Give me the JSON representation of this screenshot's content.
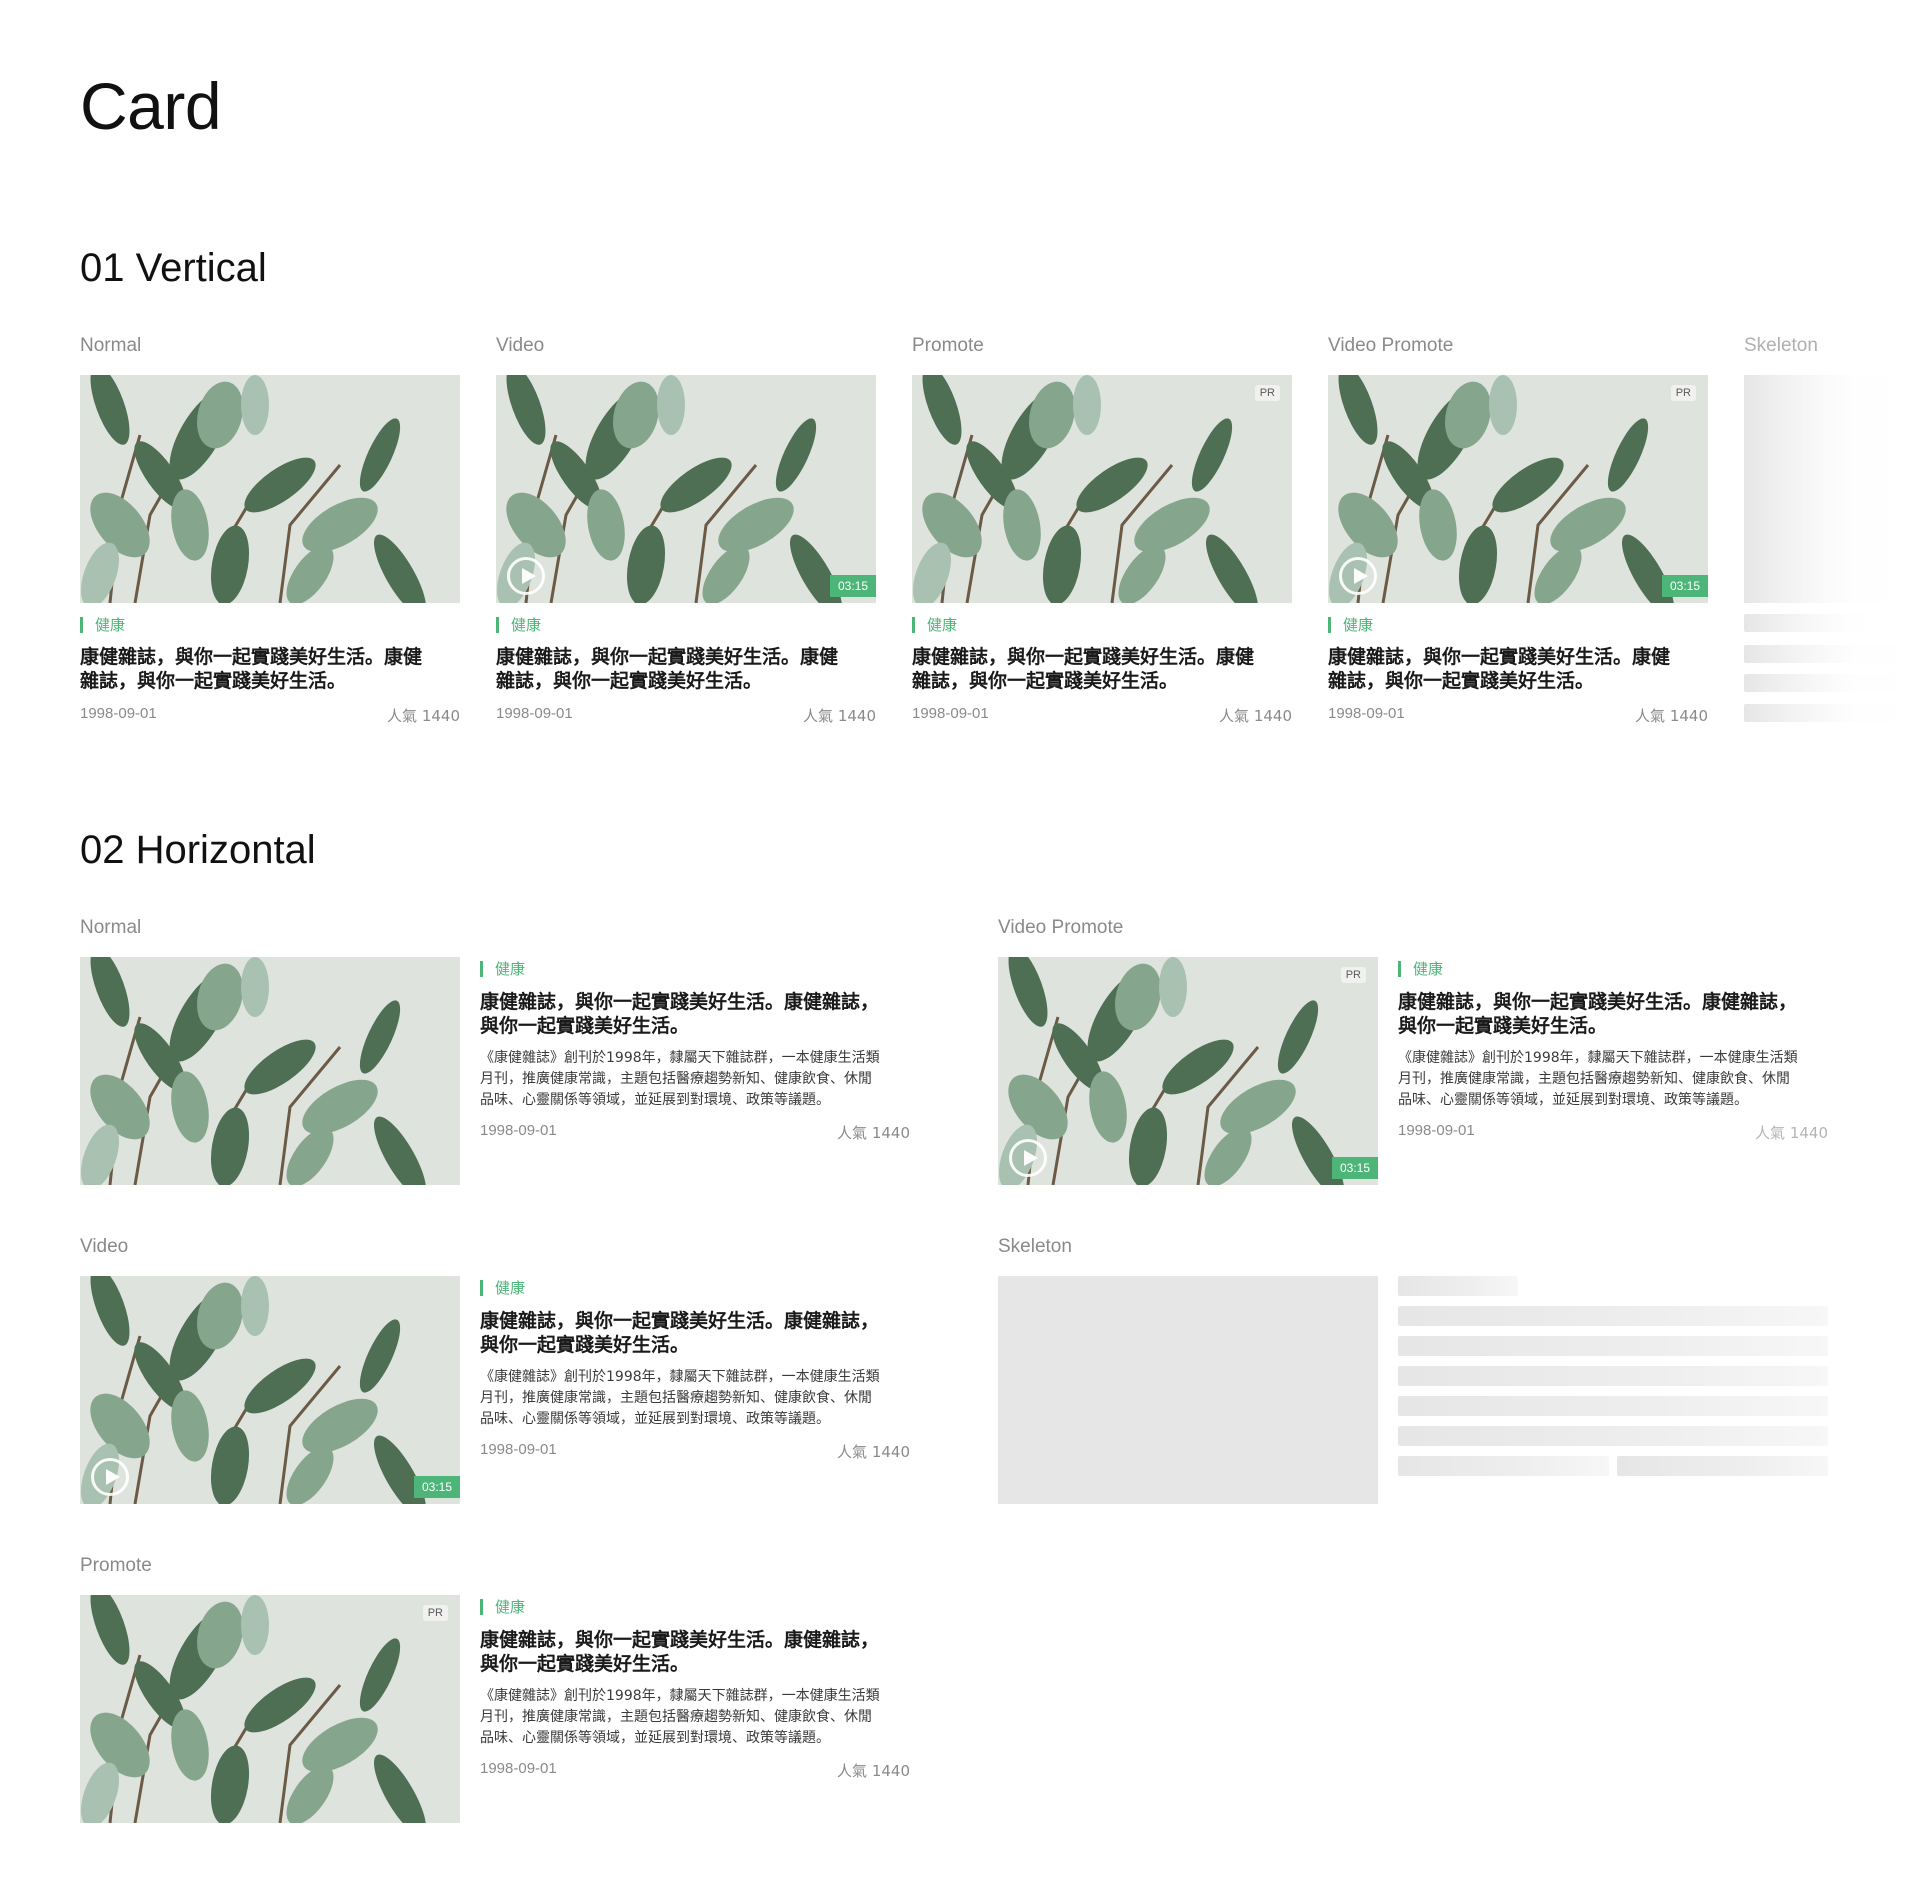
{
  "page": {
    "title": "Card"
  },
  "sections": {
    "vertical": "01 Vertical",
    "horizontal": "02 Horizontal"
  },
  "labels": {
    "normal": "Normal",
    "video": "Video",
    "promote": "Promote",
    "video_promote": "Video Promote",
    "skeleton": "Skeleton"
  },
  "card": {
    "tag": "健康",
    "title": "康健雜誌，與你一起實踐美好生活。康健雜誌，與你一起實踐美好生活。",
    "title_line1_v": "康健雜誌，與你一起實踐美好生活。康健",
    "title_line2_v": "雜誌，與你一起實踐美好生活。",
    "title_line1_h": "康健雜誌，與你一起實踐美好生活。康健雜誌，",
    "title_line2_h": "與你一起實踐美好生活。",
    "desc_line1": "《康健雜誌》創刊於1998年，隸屬天下雜誌群，一本健康生活類",
    "desc_line2": "月刊，推廣健康常識，主題包括醫療趨勢新知、健康飲食、休閒",
    "desc_line3": "品味、心靈關係等領域，並延展到對環境、政策等議題。",
    "date": "1998-09-01",
    "popularity": "人氣 1440",
    "duration": "03:15",
    "pr": "PR"
  },
  "colors": {
    "accent": "#4cb577",
    "skeleton": "#e6e6e6",
    "muted_text": "#8a8a8a"
  },
  "icons": {
    "play": "play-circle-icon"
  }
}
